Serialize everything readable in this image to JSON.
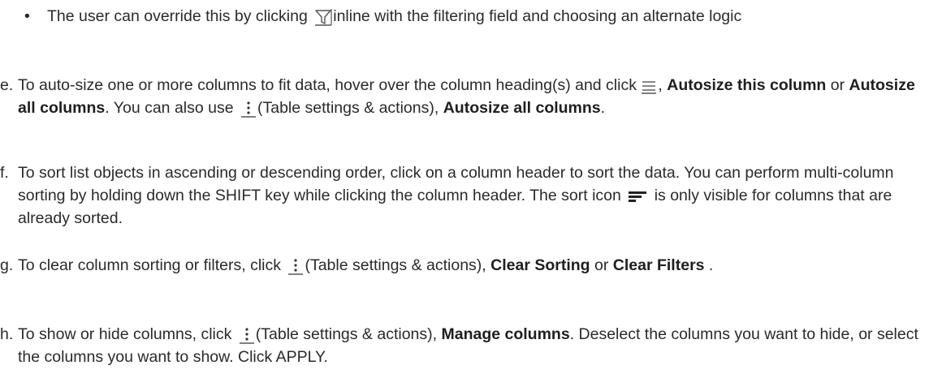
{
  "bullet": {
    "dot": "•",
    "text_before": "The user can override this by clicking",
    "text_after": "inline with the filtering field and choosing an alternate logic"
  },
  "items": [
    {
      "marker": "e.",
      "t1": "To auto-size one or more columns to fit data, hover over the column heading(s) and click",
      "t2": ",",
      "b1": "Autosize this column",
      "t3": "or",
      "b2": "Autosize all columns",
      "t4": ". You can also use",
      "t5": "(Table settings & actions),",
      "b3": "Autosize all columns",
      "t6": "."
    },
    {
      "marker": "f.",
      "t1": "To sort list objects in ascending or descending order, click on a column header to sort the data. You can perform multi-column sorting by holding down the SHIFT key while clicking the column header. The sort icon",
      "t2": "is only visible for columns that are already sorted."
    },
    {
      "marker": "g.",
      "t1": "To clear column sorting or filters, click",
      "t2": "(Table settings & actions),",
      "b1": "Clear Sorting",
      "t3": "or",
      "b2": "Clear Filters",
      "t4": "."
    },
    {
      "marker": "h.",
      "t1": "To show or hide columns, click",
      "t2": "(Table settings & actions),",
      "b1": "Manage columns",
      "t3": ". Deselect the columns you want to hide, or select the columns you want to show. Click APPLY."
    }
  ],
  "icons": {
    "filter": "filter-icon",
    "column_menu": "column-menu-icon",
    "kebab": "kebab-menu-icon",
    "sort": "sort-icon"
  },
  "colors": {
    "text": "#2a2a2a",
    "icon": "#555555",
    "sort_icon": "#222222"
  }
}
